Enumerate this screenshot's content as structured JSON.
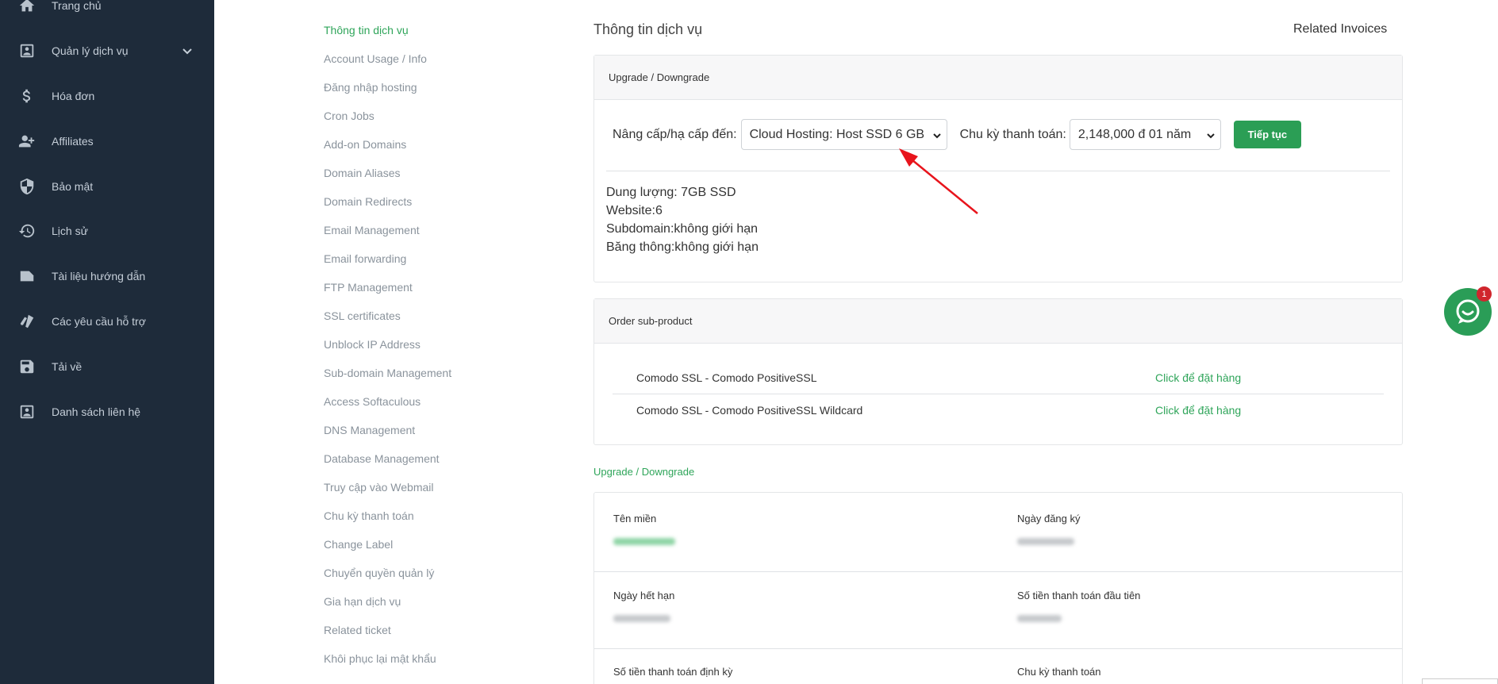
{
  "sidebar": {
    "items": [
      {
        "label": "Trang chủ",
        "icon": "home-icon"
      },
      {
        "label": "Quản lý dịch vụ",
        "icon": "contact-card-icon"
      },
      {
        "label": "Hóa đơn",
        "icon": "dollar-icon"
      },
      {
        "label": "Affiliates",
        "icon": "user-add-icon"
      },
      {
        "label": "Bảo mật",
        "icon": "shield-icon"
      },
      {
        "label": "Lịch sử",
        "icon": "history-icon"
      },
      {
        "label": "Tài liệu hướng dẫn",
        "icon": "label-tag-icon"
      },
      {
        "label": "Các yêu cầu hỗ trợ",
        "icon": "tickets-icon"
      },
      {
        "label": "Tải về",
        "icon": "save-icon"
      },
      {
        "label": "Danh sách liên hệ",
        "icon": "contact-card-icon"
      }
    ]
  },
  "subnav": {
    "items": [
      "Thông tin dịch vụ",
      "Account Usage / Info",
      "Đăng nhập hosting",
      "Cron Jobs",
      "Add-on Domains",
      "Domain Aliases",
      "Domain Redirects",
      "Email Management",
      "Email forwarding",
      "FTP Management",
      "SSL certificates",
      "Unblock IP Address",
      "Sub-domain Management",
      "Access Softaculous",
      "DNS Management",
      "Database Management",
      "Truy cập vào Webmail",
      "Chu kỳ thanh toán",
      "Change Label",
      "Chuyển quyền quản lý",
      "Gia hạn dịch vụ",
      "Related ticket",
      "Khôi phục lại mật khẩu"
    ]
  },
  "main": {
    "title": "Thông tin dịch vụ",
    "related_invoices": "Related Invoices",
    "upgrade_card": {
      "header": "Upgrade / Downgrade",
      "upgrade_label": "Nâng cấp/hạ cấp đến:",
      "plan_selected": "Cloud Hosting: Host SSD 6 GB",
      "cycle_label": "Chu kỳ thanh toán:",
      "cycle_selected": "2,148,000 đ 01 năm",
      "continue_button": "Tiếp tục",
      "specs": [
        "Dung lượng: 7GB SSD",
        "Website:6",
        "Subdomain:không giới hạn",
        "Băng thông:không giới hạn"
      ]
    },
    "sub_product_card": {
      "header": "Order sub-product",
      "rows": [
        {
          "name": "Comodo SSL - Comodo PositiveSSL",
          "action": "Click để đặt hàng"
        },
        {
          "name": "Comodo SSL - Comodo PositiveSSL Wildcard",
          "action": "Click để đặt hàng"
        }
      ]
    },
    "upgrade_link": "Upgrade / Downgrade",
    "info_card": {
      "fields": [
        {
          "label": "Tên miền"
        },
        {
          "label": "Ngày đăng ký"
        },
        {
          "label": "Ngày hết hạn"
        },
        {
          "label": "Số tiền thanh toán đầu tiên"
        },
        {
          "label": "Số tiền thanh toán định kỳ"
        },
        {
          "label": "Chu kỳ thanh toán"
        }
      ]
    }
  },
  "chat": {
    "badge": "1"
  },
  "colors": {
    "sidebar_bg": "#1e2b3a",
    "accent_green": "#2fa55a",
    "button_green": "#2b9e55",
    "annotation_red": "#e8141c",
    "badge_red": "#d0262d"
  }
}
